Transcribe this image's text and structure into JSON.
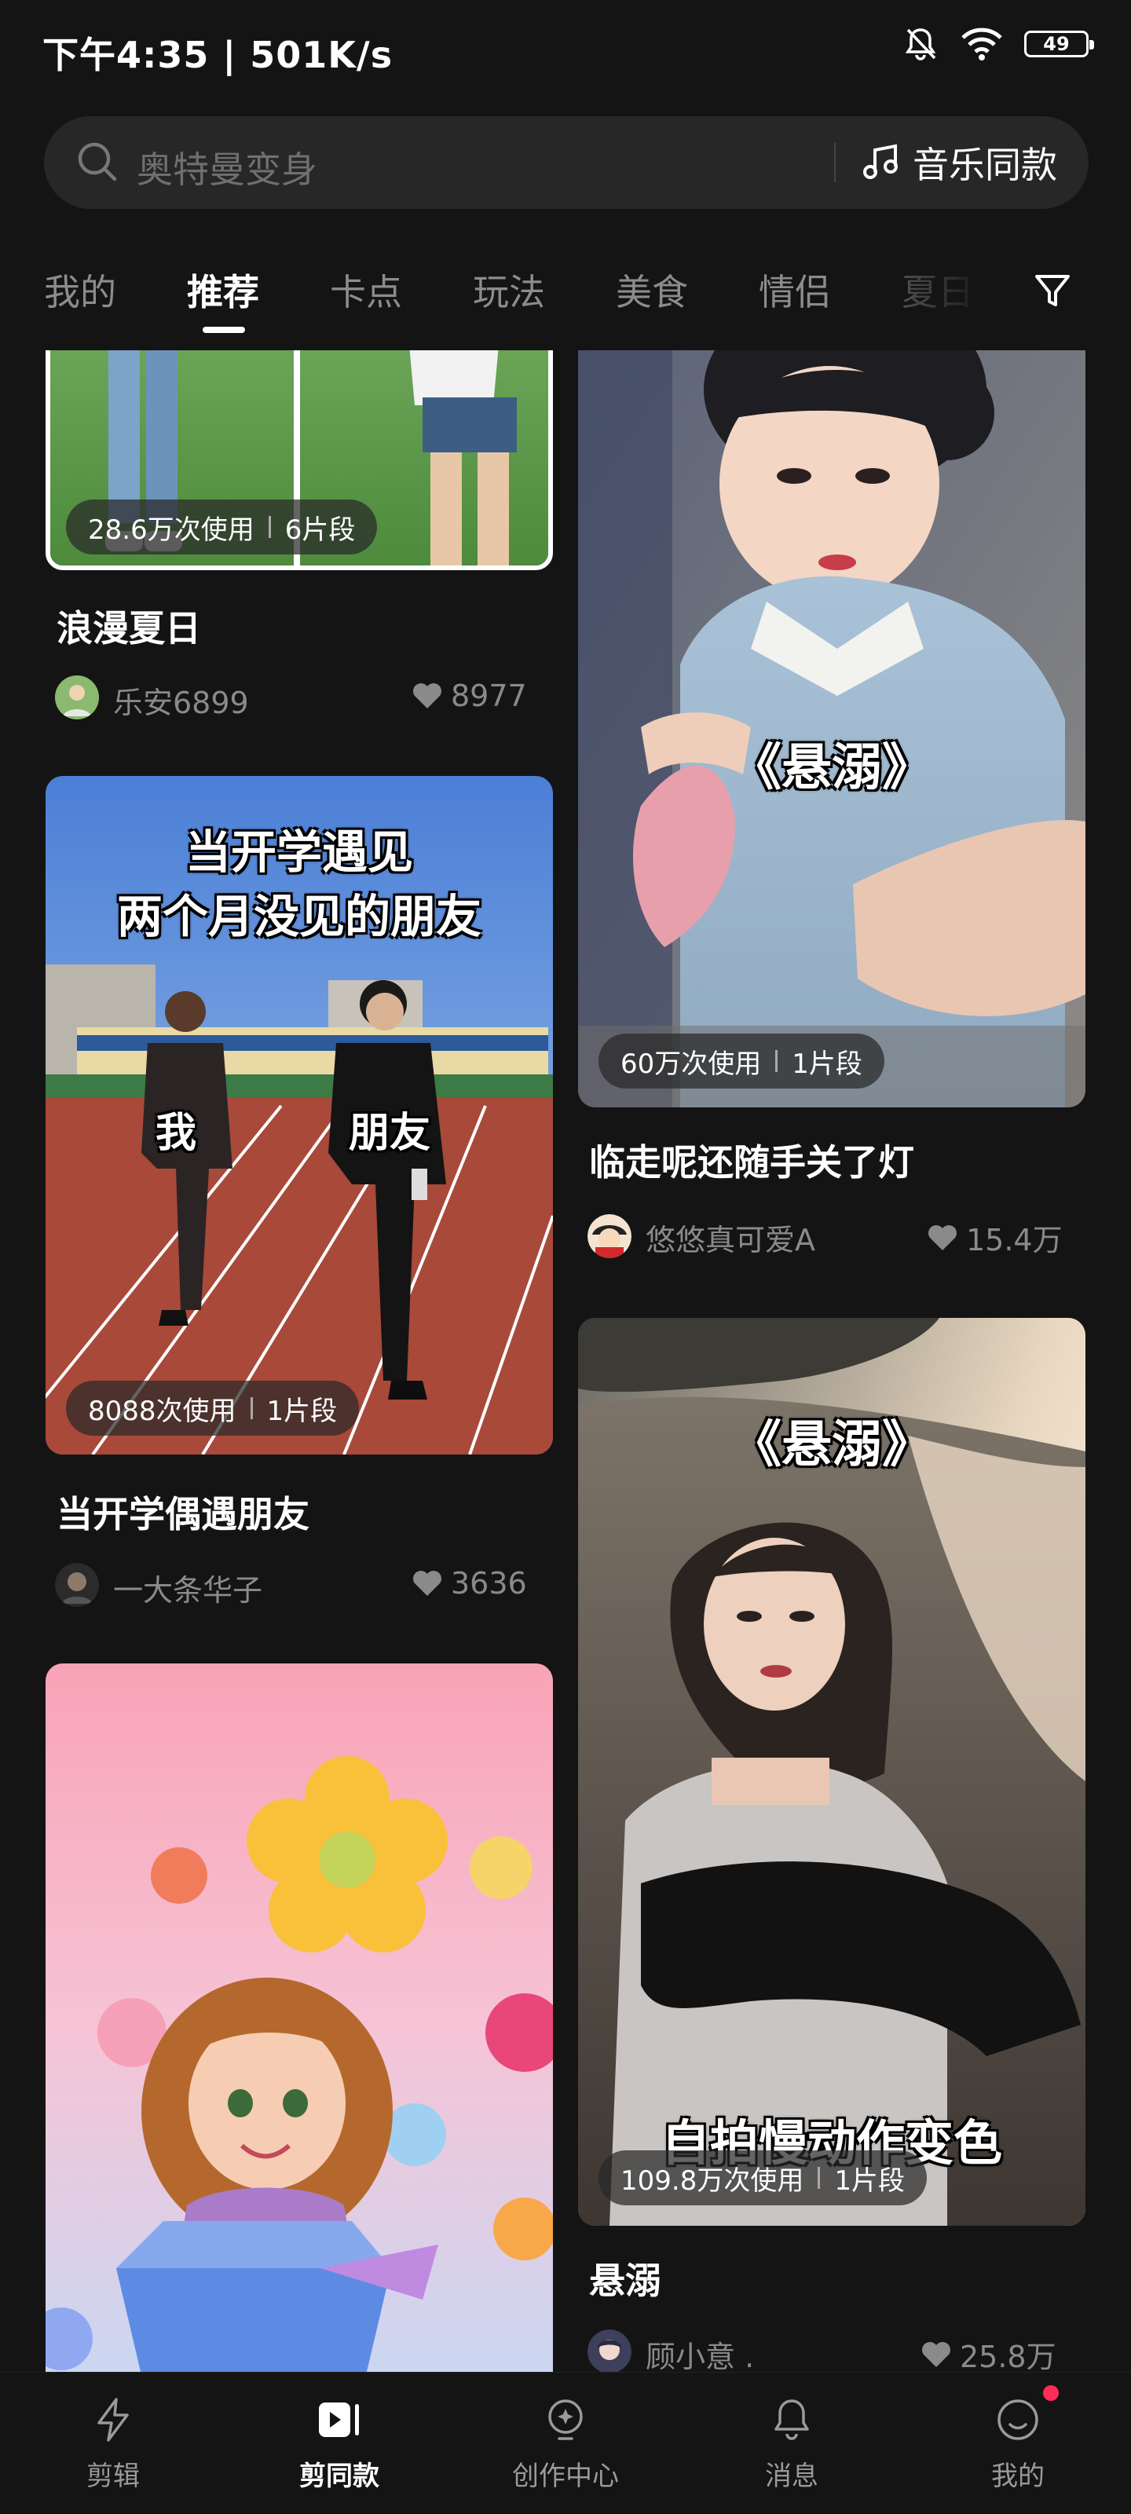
{
  "status_bar": {
    "time_speed": "下午4:35 | 501K/s",
    "battery": "49"
  },
  "search": {
    "placeholder": "奥特曼变身",
    "music_same_label": "音乐同款"
  },
  "tabs": [
    {
      "label": "我的",
      "active": false
    },
    {
      "label": "推荐",
      "active": true
    },
    {
      "label": "卡点",
      "active": false
    },
    {
      "label": "玩法",
      "active": false
    },
    {
      "label": "美食",
      "active": false
    },
    {
      "label": "情侣",
      "active": false
    },
    {
      "label": "夏日",
      "active": false
    }
  ],
  "cards": [
    {
      "title": "浪漫夏日",
      "usage": "28.6万次使用",
      "segments": "6片段",
      "author": "乐安6899",
      "likes": "8977"
    },
    {
      "title": "临走呢还随手关了灯",
      "overlay": "《悬溺》",
      "usage": "60万次使用",
      "segments": "1片段",
      "author": "悠悠真可爱A",
      "likes": "15.4万"
    },
    {
      "title": "当开学偶遇朋友",
      "overlay_line1": "当开学遇见",
      "overlay_line2": "两个月没见的朋友",
      "label_me": "我",
      "label_friend": "朋友",
      "usage": "8088次使用",
      "segments": "1片段",
      "author": "一大条华子",
      "likes": "3636"
    },
    {
      "title": "悬溺",
      "overlay_top": "《悬溺》",
      "overlay_bottom": "自拍慢动作变色",
      "usage": "109.8万次使用",
      "segments": "1片段",
      "author": "顾小意 .",
      "likes": "25.8万"
    }
  ],
  "bottom_nav": [
    {
      "label": "剪辑",
      "icon": "lightning-icon",
      "active": false
    },
    {
      "label": "剪同款",
      "icon": "play-template-icon",
      "active": true
    },
    {
      "label": "创作中心",
      "icon": "bulb-icon",
      "active": false
    },
    {
      "label": "消息",
      "icon": "bell-icon",
      "active": false
    },
    {
      "label": "我的",
      "icon": "smile-icon",
      "active": false,
      "badge": true
    }
  ],
  "colors": {
    "background": "#141414",
    "search_bg": "#272727",
    "muted_text": "#8a8a8a",
    "badge_red": "#ff2d55"
  }
}
